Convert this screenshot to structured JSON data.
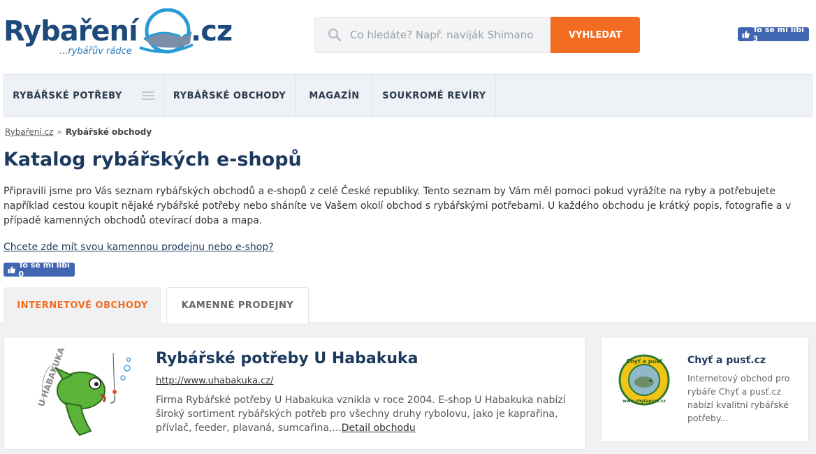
{
  "header": {
    "logo_main": "Rybaření",
    "logo_domain": ".cz",
    "logo_tagline": "...rybářův rádce",
    "search_placeholder": "Co hledáte? Např. naviják Shimano",
    "search_button": "VYHLEDAT",
    "fb_like_top": "To se mi líbí 3"
  },
  "nav": {
    "items": [
      {
        "label": "RYBÁŘSKÉ POTŘEBY"
      },
      {
        "label": "RYBÁŘSKÉ OBCHODY"
      },
      {
        "label": "MAGAZÍN"
      },
      {
        "label": "SOUKROMÉ REVÍRY"
      }
    ]
  },
  "breadcrumb": {
    "home": "Rybaření.cz",
    "separator": "»",
    "current": "Rybářské obchody"
  },
  "page": {
    "title": "Katalog rybářských e-shopů",
    "intro": "Připravili jsme pro Vás seznam rybářských obchodů a e-shopů z celé České republiky. Tento seznam by Vám měl pomoci pokud vyrážíte na ryby a potřebujete například cestou koupit nějaké rybářské potřeby nebo sháníte ve Vašem okolí obchod s rybářskými potřebami. U každého obchodu je krátký popis, fotografie a v případě kamenných obchodů otevírací doba a mapa.",
    "cta_link": "Chcete zde mít svou kamennou prodejnu nebo e-shop?",
    "fb_like": "To se mi líbí 0"
  },
  "tabs": [
    {
      "label": "INTERNETOVÉ OBCHODY",
      "active": true
    },
    {
      "label": "KAMENNÉ PRODEJNY",
      "active": false
    }
  ],
  "shops": {
    "main": {
      "logo_text": "U HABAKUKA",
      "title": "Rybářské potřeby U Habakuka",
      "url": "http://www.uhabakuka.cz/",
      "description": "Firma Rybářské potřeby U Habakuka vznikla v roce 2004. E-shop U Habakuka nabízí široký sortiment rybářských potřeb pro všechny druhy rybolovu, jako je kaprařina, přívlač, feeder, plavaná, sumcařina,...",
      "detail_link": "Detail obchodu"
    },
    "side": {
      "logo_text_top": "Chyť a pusť",
      "logo_text_bottom": "www.chytapust.cz",
      "title": "Chyť a pusť.cz",
      "description": "Internetový obchod pro rybáře Chyť a pusť.cz nabízí kvalitní rybářské potřeby..."
    }
  },
  "colors": {
    "brand_blue": "#1d4a7a",
    "accent_orange": "#f26c21",
    "facebook": "#4267b2"
  }
}
